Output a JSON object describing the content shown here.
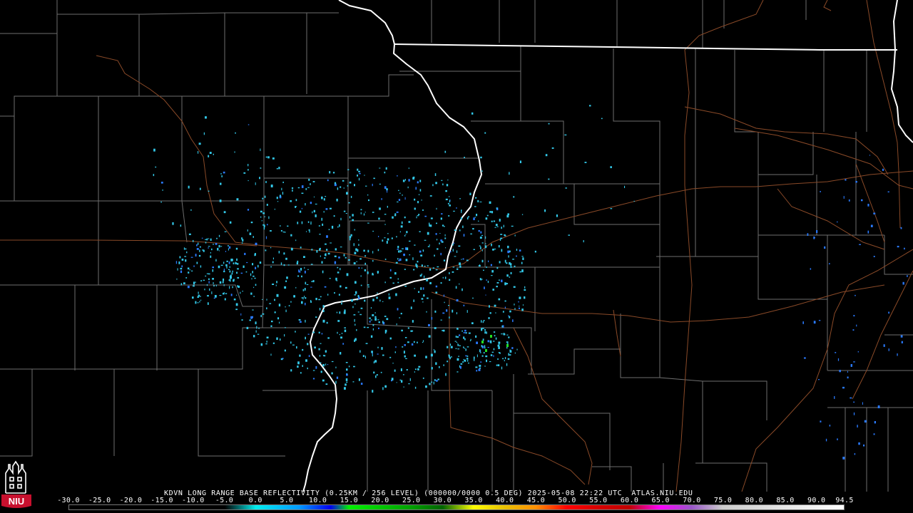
{
  "radar": {
    "caption": "KDVN LONG RANGE BASE REFLECTIVITY (0.25KM / 256 LEVEL) (000000/0000 0.5 DEG) 2025-05-08 22:22 UTC  ATLAS.NIU.EDU",
    "station": "KDVN",
    "product": "LONG RANGE BASE REFLECTIVITY",
    "timestamp": "2025-05-08 22:22 UTC",
    "source": "ATLAS.NIU.EDU"
  },
  "legend": {
    "ticks": [
      "-30.0",
      "-25.0",
      "-20.0",
      "-15.0",
      "-10.0",
      "-5.0",
      "0.0",
      "5.0",
      "10.0",
      "15.0",
      "20.0",
      "25.0",
      "30.0",
      "35.0",
      "40.0",
      "45.0",
      "50.0",
      "55.0",
      "60.0",
      "65.0",
      "70.0",
      "75.0",
      "80.0",
      "85.0",
      "90.0",
      "94.5"
    ],
    "min": -30.0,
    "max": 94.5,
    "colors": [
      {
        "v": -30,
        "c": "#000000"
      },
      {
        "v": -5,
        "c": "#000000"
      },
      {
        "v": 0,
        "c": "#00eeee"
      },
      {
        "v": 7,
        "c": "#0099ff"
      },
      {
        "v": 12,
        "c": "#0000f0"
      },
      {
        "v": 15,
        "c": "#00f000"
      },
      {
        "v": 25,
        "c": "#00a000"
      },
      {
        "v": 30,
        "c": "#006400"
      },
      {
        "v": 35,
        "c": "#ffff00"
      },
      {
        "v": 40,
        "c": "#e7c000"
      },
      {
        "v": 45,
        "c": "#ff9000"
      },
      {
        "v": 50,
        "c": "#ff0000"
      },
      {
        "v": 55,
        "c": "#d60000"
      },
      {
        "v": 60,
        "c": "#c00000"
      },
      {
        "v": 65,
        "c": "#ff00ff"
      },
      {
        "v": 70,
        "c": "#9955c9"
      },
      {
        "v": 75,
        "c": "#cccccc"
      },
      {
        "v": 94.5,
        "c": "#ffffff"
      }
    ]
  },
  "logo": {
    "text": "NIU",
    "color": "#c8102e"
  },
  "colors": {
    "background": "#000000",
    "county_lines": "#6e6e6e",
    "state_lines": "#ffffff",
    "highways": "#8a4a28",
    "echo_light": "#33c8e8",
    "echo_medium": "#2a7aff",
    "echo_strong": "#22dd22"
  }
}
